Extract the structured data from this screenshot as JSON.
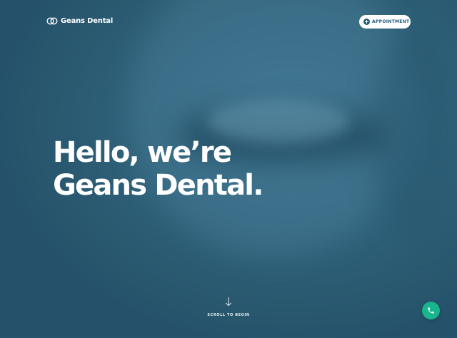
{
  "brand": {
    "name": "Geans Dental",
    "logo_icon": "double-ring-logo-icon"
  },
  "header": {
    "appointment_label": "APPOINTMENT",
    "appointment_icon": "plus-circle-icon"
  },
  "hero": {
    "title_line1": "Hello, we’re",
    "title_line2": "Geans Dental."
  },
  "scroll": {
    "label": "SCROLL TO BEGIN",
    "icon": "arrow-down-icon"
  },
  "call_button": {
    "icon": "phone-icon"
  },
  "colors": {
    "background": "#2d5f77",
    "accent": "#19b58c",
    "brand_blue": "#1d5c7a",
    "text": "#ffffff"
  }
}
